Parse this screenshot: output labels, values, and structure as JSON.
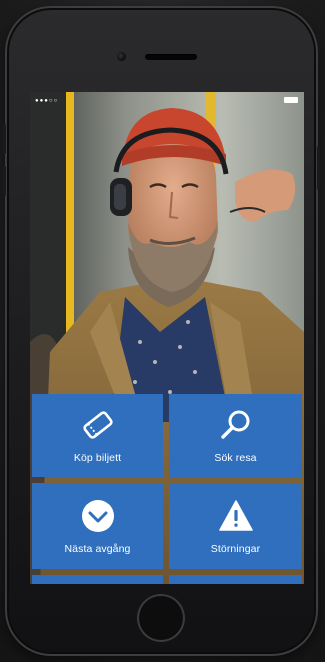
{
  "device": {
    "type": "phone-mockup"
  },
  "statusbar": {
    "signal_icon": "signal-dots-icon",
    "battery_icon": "battery-icon"
  },
  "hero": {
    "image_icon": "man-with-headphones-photo"
  },
  "menu": {
    "tiles": [
      {
        "label": "Köp biljett",
        "icon": "ticket-icon"
      },
      {
        "label": "Sök resa",
        "icon": "search-icon"
      },
      {
        "label": "Nästa avgång",
        "icon": "chevron-down-circle-icon"
      },
      {
        "label": "Störningar",
        "icon": "warning-icon"
      }
    ]
  },
  "colors": {
    "tile_blue": "#2f6fbd",
    "beanie_red": "#c9462e",
    "pole_yellow": "#e7b820",
    "jacket_olive": "#8a6a3a"
  }
}
